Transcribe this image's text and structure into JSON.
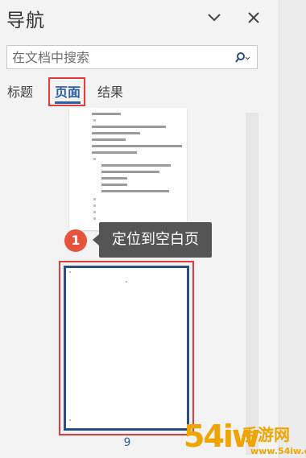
{
  "header": {
    "title": "导航"
  },
  "search": {
    "placeholder": "在文档中搜索"
  },
  "tabs": [
    {
      "label": "标题"
    },
    {
      "label": "页面"
    },
    {
      "label": "结果"
    }
  ],
  "callout": {
    "number": "1",
    "text": "定位到空白页"
  },
  "pages": [
    {
      "number": "9"
    }
  ],
  "watermark": {
    "brand": "54iw",
    "cn": "手游网",
    "site": "www.54iw.cn"
  },
  "colors": {
    "accent": "#2c5fa8",
    "highlight": "#e23b3b",
    "badge": "#e5533d"
  }
}
